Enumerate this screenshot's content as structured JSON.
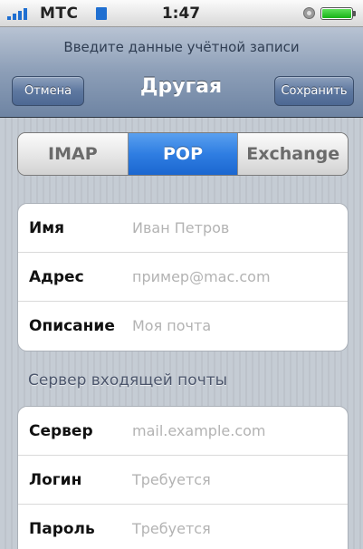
{
  "status": {
    "carrier": "МТС",
    "time": "1:47"
  },
  "nav": {
    "prompt": "Введите данные учётной записи",
    "title": "Другая",
    "cancel_label": "Отмена",
    "save_label": "Сохранить"
  },
  "segments": [
    "IMAP",
    "POP",
    "Exchange"
  ],
  "segment_selected": "POP",
  "account_fields": [
    {
      "label": "Имя",
      "placeholder": "Иван Петров"
    },
    {
      "label": "Адрес",
      "placeholder": "пример@mac.com"
    },
    {
      "label": "Описание",
      "placeholder": "Моя почта"
    }
  ],
  "incoming_header": "Сервер входящей почты",
  "incoming_fields": [
    {
      "label": "Сервер",
      "placeholder": "mail.example.com"
    },
    {
      "label": "Логин",
      "placeholder": "Требуется"
    },
    {
      "label": "Пароль",
      "placeholder": "Требуется"
    }
  ],
  "colors": {
    "accent": "#2f7ee2",
    "nav": "#6e84a3",
    "background": "#c5ccd4"
  },
  "icons": [
    "signal-icon",
    "edge-icon",
    "lock-icon",
    "battery-icon"
  ]
}
